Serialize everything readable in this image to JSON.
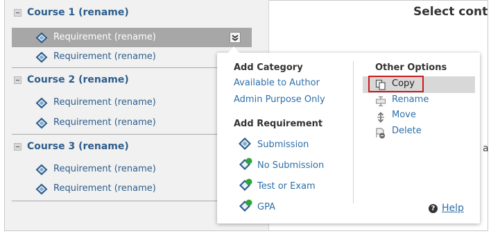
{
  "header": {
    "title": "Select conten"
  },
  "tree": {
    "courses": [
      {
        "title": "Course 1 (rename)",
        "requirements": [
          {
            "label": "Requirement (rename)"
          },
          {
            "label": "Requirement (rename)"
          }
        ]
      },
      {
        "title": "Course 2 (rename)",
        "requirements": [
          {
            "label": "Requirement (rename)"
          },
          {
            "label": "Requirement (rename)"
          }
        ]
      },
      {
        "title": "Course 3 (rename)",
        "requirements": [
          {
            "label": "Requirement (rename)"
          },
          {
            "label": "Requirement (rename)"
          }
        ]
      }
    ]
  },
  "partial_text": "a",
  "menu": {
    "add_category": {
      "heading": "Add Category",
      "items": [
        {
          "label": "Available to Author"
        },
        {
          "label": "Admin Purpose Only"
        }
      ]
    },
    "add_requirement": {
      "heading": "Add Requirement",
      "items": [
        {
          "label": "Submission"
        },
        {
          "label": "No Submission"
        },
        {
          "label": "Test or Exam"
        },
        {
          "label": "GPA"
        }
      ]
    },
    "other_options": {
      "heading": "Other Options",
      "items": [
        {
          "label": "Copy"
        },
        {
          "label": "Rename"
        },
        {
          "label": "Move"
        },
        {
          "label": "Delete"
        }
      ]
    },
    "help": {
      "label": "Help"
    }
  },
  "colors": {
    "link": "#2d6fa8",
    "course_title": "#2d5d8b",
    "selected_row": "#a7a7a7",
    "copy_highlight_border": "#cc1a1a",
    "status_dot": "#2ca53a"
  }
}
